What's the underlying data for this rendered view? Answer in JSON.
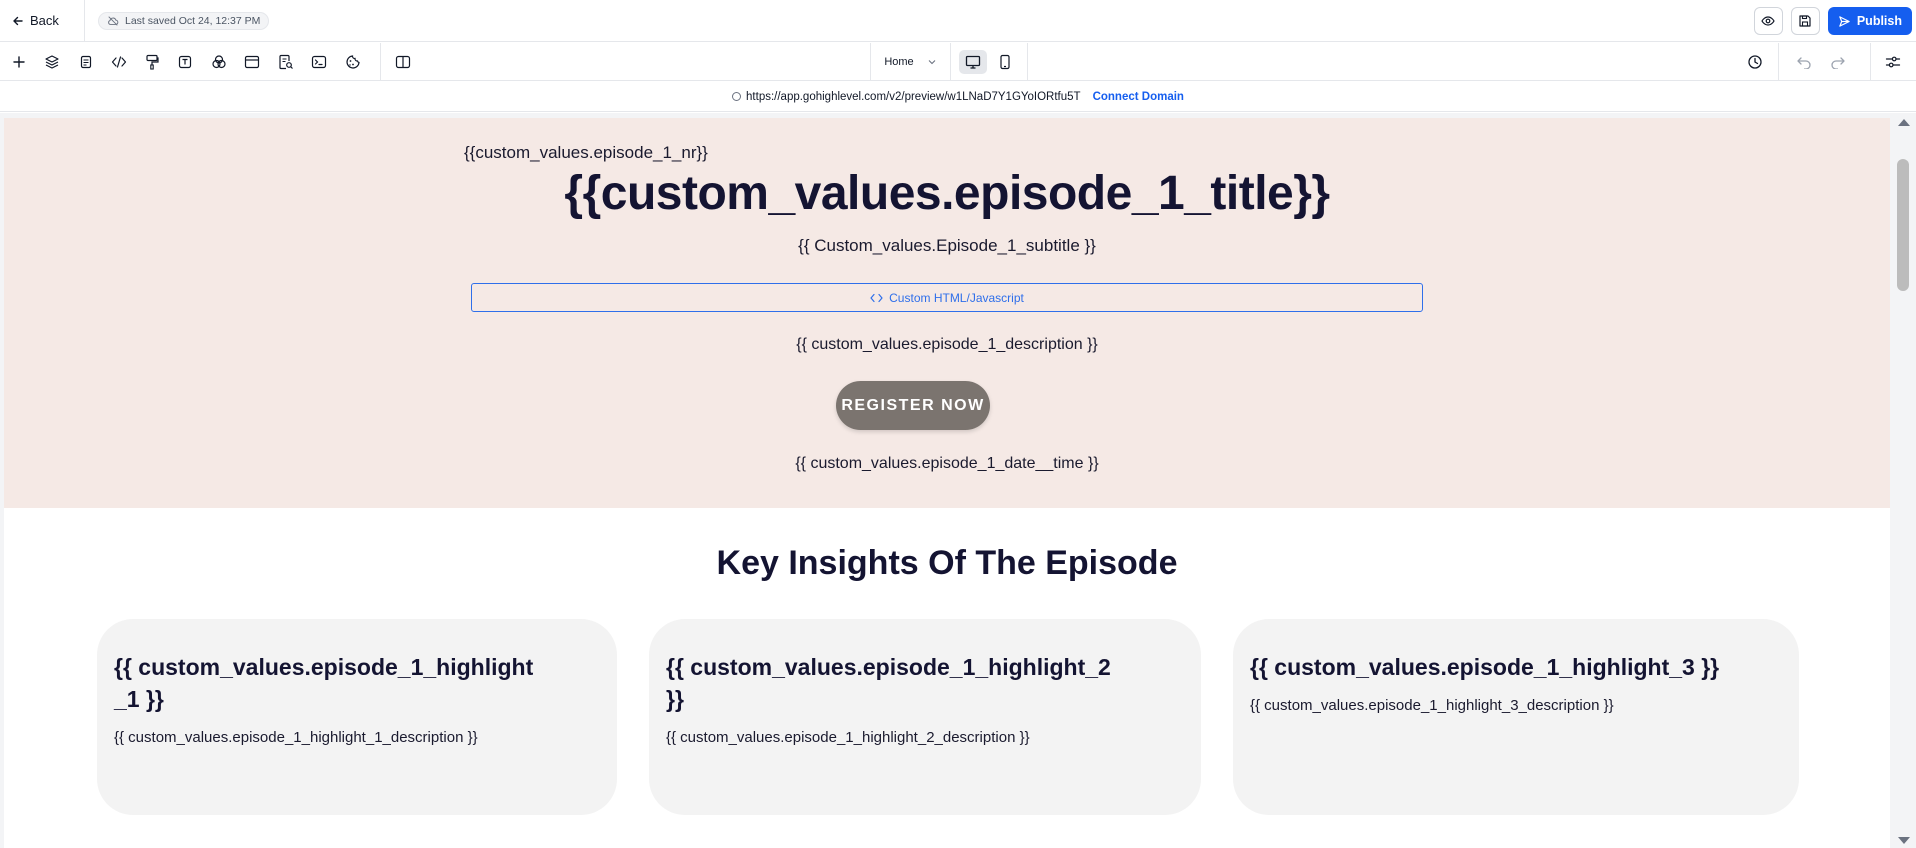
{
  "topbar": {
    "back_label": "Back",
    "last_saved": "Last saved Oct 24, 12:37 PM",
    "publish_label": "Publish"
  },
  "toolbar": {
    "page_select": "Home",
    "tools": [
      "add-icon",
      "layers-icon",
      "pages-icon",
      "code-icon",
      "paint-roller-icon",
      "text-icon",
      "color-circles-icon",
      "browser-window-icon",
      "form-search-icon",
      "terminal-icon",
      "cookie-icon",
      "split-view-icon"
    ]
  },
  "urlbar": {
    "url": "https://app.gohighlevel.com/v2/preview/w1LNaD7Y1GYoIORtfu5T",
    "connect_domain": "Connect Domain"
  },
  "hero": {
    "episode_nr": "{{custom_values.episode_1_nr}}",
    "title": "{{custom_values.episode_1_title}}",
    "subtitle": "{{ Custom_values.Episode_1_subtitle }}",
    "html_block": "Custom HTML/Javascript",
    "description": "{{ custom_values.episode_1_description }}",
    "register_label": "REGISTER NOW",
    "date_time": "{{ custom_values.episode_1_date__time }}",
    "background": "#f5e9e5",
    "button_color": "#7b746f"
  },
  "insights": {
    "title": "Key Insights Of The Episode",
    "cards": [
      {
        "title": "{{ custom_values.episode_1_highlight_1 }}",
        "description": "{{ custom_values.episode_1_highlight_1_description }}"
      },
      {
        "title": "{{ custom_values.episode_1_highlight_2 }}",
        "description": "{{ custom_values.episode_1_highlight_2_description }}"
      },
      {
        "title": "{{ custom_values.episode_1_highlight_3 }}",
        "description": "{{ custom_values.episode_1_highlight_3_description }}"
      }
    ]
  },
  "colors": {
    "accent": "#155eef",
    "heading": "#141432"
  }
}
